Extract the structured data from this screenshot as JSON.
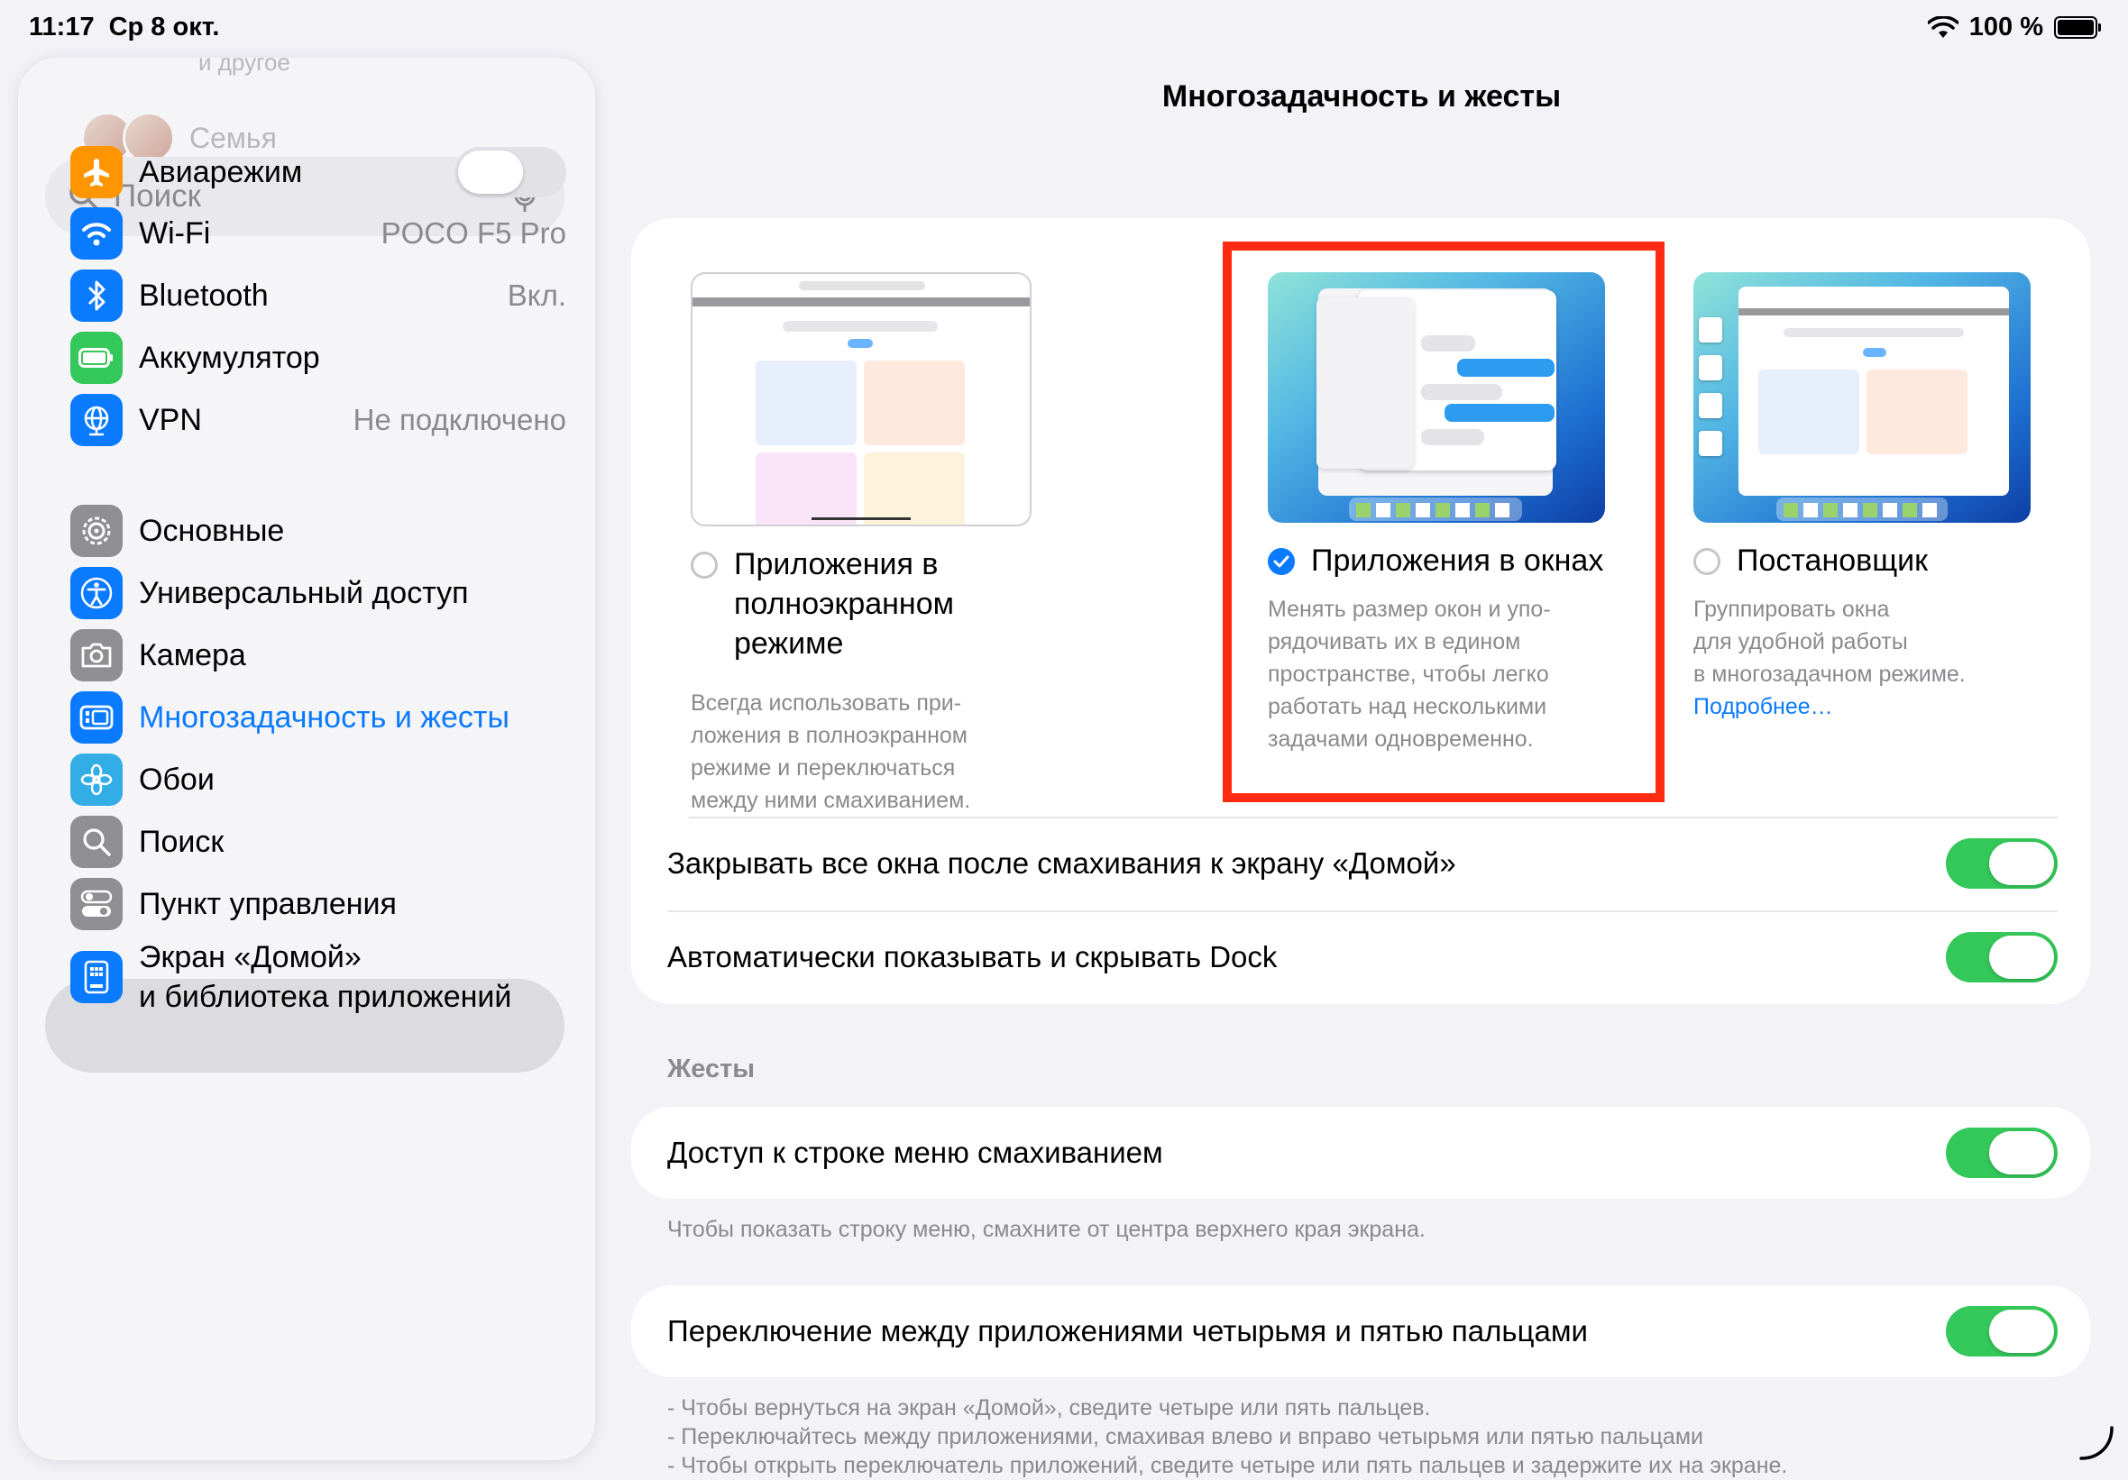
{
  "status": {
    "time": "11:17",
    "date": "Ср 8 окт.",
    "battery": "100 %"
  },
  "sidebar": {
    "more_faded": "и другое",
    "family": "Семья",
    "search_placeholder": "Поиск",
    "airplane": {
      "label": "Авиарежим",
      "on": false
    },
    "wifi": {
      "label": "Wi-Fi",
      "value": "POCO F5 Pro"
    },
    "bluetooth": {
      "label": "Bluetooth",
      "value": "Вкл."
    },
    "battery": {
      "label": "Аккумулятор"
    },
    "vpn": {
      "label": "VPN",
      "value": "Не подключено"
    },
    "general": {
      "label": "Основные"
    },
    "accessibility": {
      "label": "Универсальный доступ"
    },
    "camera": {
      "label": "Камера"
    },
    "multitasking": {
      "label": "Многозадачность и жесты"
    },
    "wallpaper": {
      "label": "Обои"
    },
    "search": {
      "label": "Поиск"
    },
    "control_center": {
      "label": "Пункт управления"
    },
    "home_screen": {
      "label1": "Экран «Домой»",
      "label2": "и библиотека приложений"
    }
  },
  "main": {
    "title": "Многозадачность и жесты",
    "options": [
      {
        "title": "Приложения в полноэкранном режиме",
        "desc": "Всегда использовать при-\nложения в полноэкранном\nрежиме и переключаться\nмежду ними смахиванием.",
        "selected": false
      },
      {
        "title": "Приложения в окнах",
        "desc": "Менять размер окон и упо-\nрядочивать их в едином\nпространстве, чтобы легко\nработать над несколькими\nзадачами одновременно.",
        "selected": true
      },
      {
        "title": "Постановщик",
        "desc": "Группировать окна\nдля удобной работы\nв многозадачном режиме.",
        "link": "Подробнее…",
        "selected": false
      }
    ],
    "close_windows": {
      "label": "Закрывать все окна после смахивания к экрану «Домой»",
      "on": true
    },
    "auto_dock": {
      "label": "Автоматически показывать и скрывать Dock",
      "on": true
    },
    "gestures_header": "Жесты",
    "menu_swipe": {
      "label": "Доступ к строке меню смахиванием",
      "on": true
    },
    "menu_swipe_note": "Чтобы показать строку меню, смахните от центра верхнего края экрана.",
    "four_five": {
      "label": "Переключение между приложениями четырьмя и пятью пальцами",
      "on": true
    },
    "notes": [
      "- Чтобы вернуться на экран «Домой», сведите четыре или пять пальцев.",
      "- Переключайтесь между приложениями, смахивая влево и вправо четырьмя или пятью пальцами",
      "- Чтобы открыть переключатель приложений, сведите четыре или пять пальцев и задержите их на экране."
    ]
  },
  "colors": {
    "accent": "#0a7aff",
    "switch_on": "#34c759",
    "highlight": "#ff2a12"
  }
}
